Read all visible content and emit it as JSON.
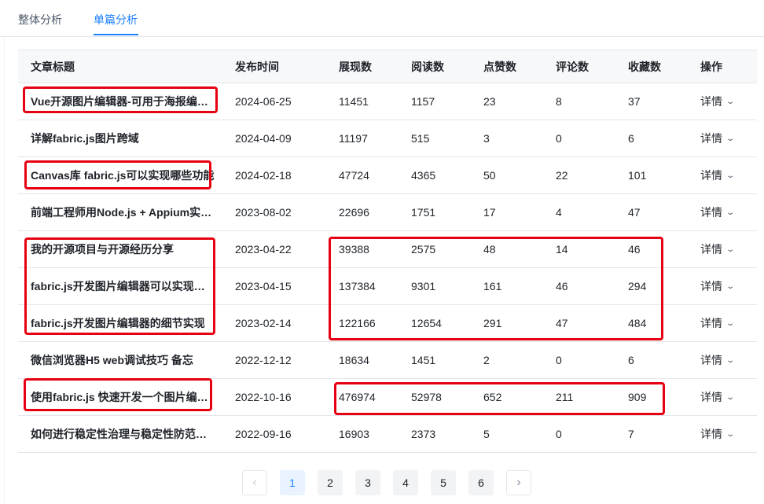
{
  "tabs": [
    {
      "label": "整体分析",
      "active": false
    },
    {
      "label": "单篇分析",
      "active": true
    }
  ],
  "table": {
    "headers": [
      "文章标题",
      "发布时间",
      "展现数",
      "阅读数",
      "点赞数",
      "评论数",
      "收藏数",
      "操作"
    ],
    "rows": [
      {
        "title": "Vue开源图片编辑器-可用于海报编辑、广告设计",
        "date": "2024-06-25",
        "views": "11451",
        "reads": "1157",
        "likes": "23",
        "comments": "8",
        "favorites": "37",
        "action": "详情"
      },
      {
        "title": "详解fabric.js图片跨域",
        "date": "2024-04-09",
        "views": "11197",
        "reads": "515",
        "likes": "3",
        "comments": "0",
        "favorites": "6",
        "action": "详情"
      },
      {
        "title": "Canvas库 fabric.js可以实现哪些功能",
        "date": "2024-02-18",
        "views": "47724",
        "reads": "4365",
        "likes": "50",
        "comments": "22",
        "favorites": "101",
        "action": "详情"
      },
      {
        "title": "前端工程师用Node.js + Appium实现自动化",
        "date": "2023-08-02",
        "views": "22696",
        "reads": "1751",
        "likes": "17",
        "comments": "4",
        "favorites": "47",
        "action": "详情"
      },
      {
        "title": "我的开源项目与开源经历分享",
        "date": "2023-04-22",
        "views": "39388",
        "reads": "2575",
        "likes": "48",
        "comments": "14",
        "favorites": "46",
        "action": "详情"
      },
      {
        "title": "fabric.js开发图片编辑器可以实现哪些功能",
        "date": "2023-04-15",
        "views": "137384",
        "reads": "9301",
        "likes": "161",
        "comments": "46",
        "favorites": "294",
        "action": "详情"
      },
      {
        "title": "fabric.js开发图片编辑器的细节实现",
        "date": "2023-02-14",
        "views": "122166",
        "reads": "12654",
        "likes": "291",
        "comments": "47",
        "favorites": "484",
        "action": "详情"
      },
      {
        "title": "微信浏览器H5 web调试技巧 备忘",
        "date": "2022-12-12",
        "views": "18634",
        "reads": "1451",
        "likes": "2",
        "comments": "0",
        "favorites": "6",
        "action": "详情"
      },
      {
        "title": "使用fabric.js 快速开发一个图片编辑器",
        "date": "2022-10-16",
        "views": "476974",
        "reads": "52978",
        "likes": "652",
        "comments": "211",
        "favorites": "909",
        "action": "详情"
      },
      {
        "title": "如何进行稳定性治理与稳定性防范措施",
        "date": "2022-09-16",
        "views": "16903",
        "reads": "2373",
        "likes": "5",
        "comments": "0",
        "favorites": "7",
        "action": "详情"
      }
    ]
  },
  "pagination": {
    "prev_icon": "chevron-left-icon",
    "next_icon": "chevron-right-icon",
    "pages": [
      "1",
      "2",
      "3",
      "4",
      "5",
      "6"
    ],
    "current": "1"
  },
  "annotation_color": "#e60012",
  "accent_color": "#1e80ff"
}
